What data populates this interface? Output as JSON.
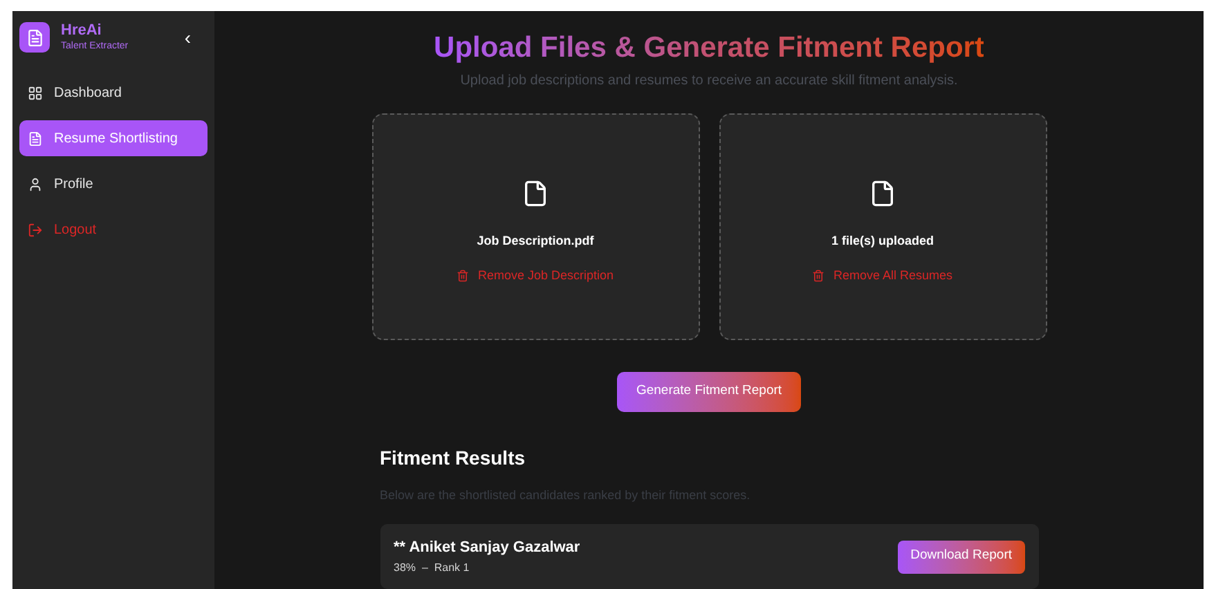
{
  "sidebar": {
    "brand": "HreAi",
    "tagline": "Talent Extracter",
    "collapse": "‹",
    "items": [
      {
        "label": "Dashboard",
        "selected": false,
        "kind": "link"
      },
      {
        "label": "Resume Shortlisting",
        "selected": true,
        "kind": "link"
      },
      {
        "label": "Profile",
        "selected": false,
        "kind": "link"
      },
      {
        "label": "Logout",
        "selected": false,
        "kind": "danger"
      }
    ]
  },
  "header": {
    "title": "Upload Files & Generate Fitment Report",
    "subtitle": "Upload job descriptions and resumes to receive an accurate skill fitment analysis."
  },
  "uploads": [
    {
      "file": "Job Description.pdf",
      "action": "Remove Job Description"
    },
    {
      "file": "1 file(s) uploaded",
      "action": "Remove All Resumes"
    }
  ],
  "generate_button": "Generate Fitment Report",
  "results": {
    "title": "Fitment Results",
    "subtitle": "Below are the shortlisted candidates ranked by their fitment scores.",
    "candidates": [
      {
        "name": "** Aniket Sanjay Gazalwar",
        "score": "38%  –  Rank 1",
        "button": "Download Report"
      }
    ]
  }
}
